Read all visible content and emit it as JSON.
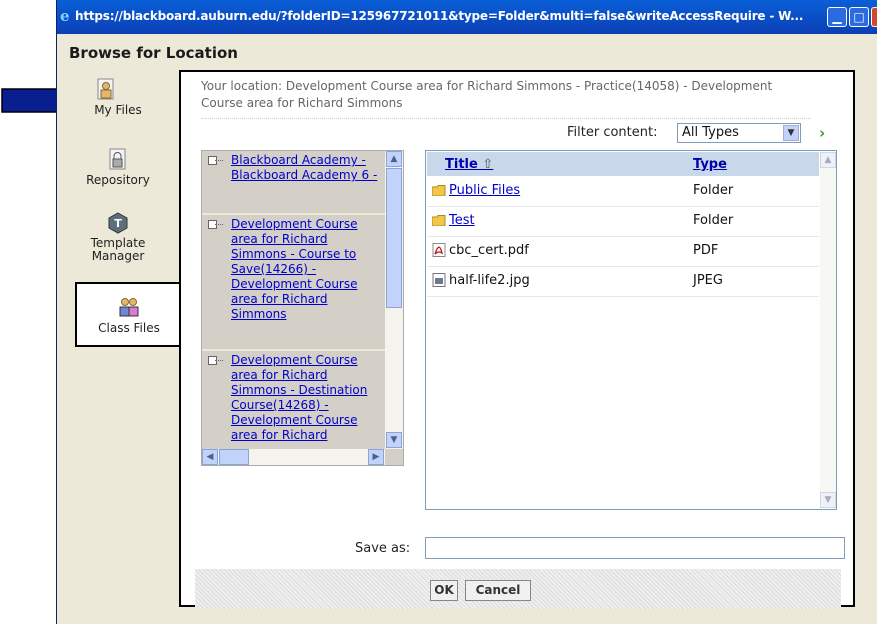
{
  "window": {
    "title": "https://blackboard.auburn.edu/?folderID=125967721011&type=Folder&multi=false&writeAccessRequire - W...",
    "dialog_title": "Browse for Location"
  },
  "sidebar": {
    "items": [
      {
        "label": "My Files",
        "icon": "user-files-icon",
        "active": false
      },
      {
        "label": "Repository",
        "icon": "repository-icon",
        "active": false
      },
      {
        "label": "Template Manager",
        "icon": "template-manager-icon",
        "active": false
      },
      {
        "label": "Class Files",
        "icon": "class-files-icon",
        "active": true
      }
    ]
  },
  "location": {
    "text": "Your location: Development Course area for Richard Simmons - Practice(14058) - Development Course area for Richard Simmons"
  },
  "filter": {
    "label": "Filter content:",
    "value": "All Types"
  },
  "tree": {
    "nodes": [
      {
        "label": "Blackboard Academy - Blackboard Academy 6 -"
      },
      {
        "label": "Development Course area for Richard Simmons - Course to Save(14266) - Development Course area for Richard Simmons"
      },
      {
        "label": "Development Course area for Richard Simmons - Destination Course(14268) - Development Course area for Richard"
      }
    ]
  },
  "file_list": {
    "columns": [
      "Title",
      "Type"
    ],
    "rows": [
      {
        "name": "Public Files",
        "type": "Folder",
        "icon": "folder-icon",
        "link": true
      },
      {
        "name": "Test",
        "type": "Folder",
        "icon": "folder-icon",
        "link": true
      },
      {
        "name": "cbc_cert.pdf",
        "type": "PDF",
        "icon": "pdf-icon",
        "link": false
      },
      {
        "name": "half-life2.jpg",
        "type": "JPEG",
        "icon": "image-file-icon",
        "link": false
      }
    ]
  },
  "save_as": {
    "label": "Save as:",
    "value": ""
  },
  "buttons": {
    "ok": "OK",
    "cancel": "Cancel"
  },
  "colors": {
    "titlebar": "#0b4fc7",
    "link": "#0000cc",
    "pointer_arrow": "#0a1f8f"
  }
}
